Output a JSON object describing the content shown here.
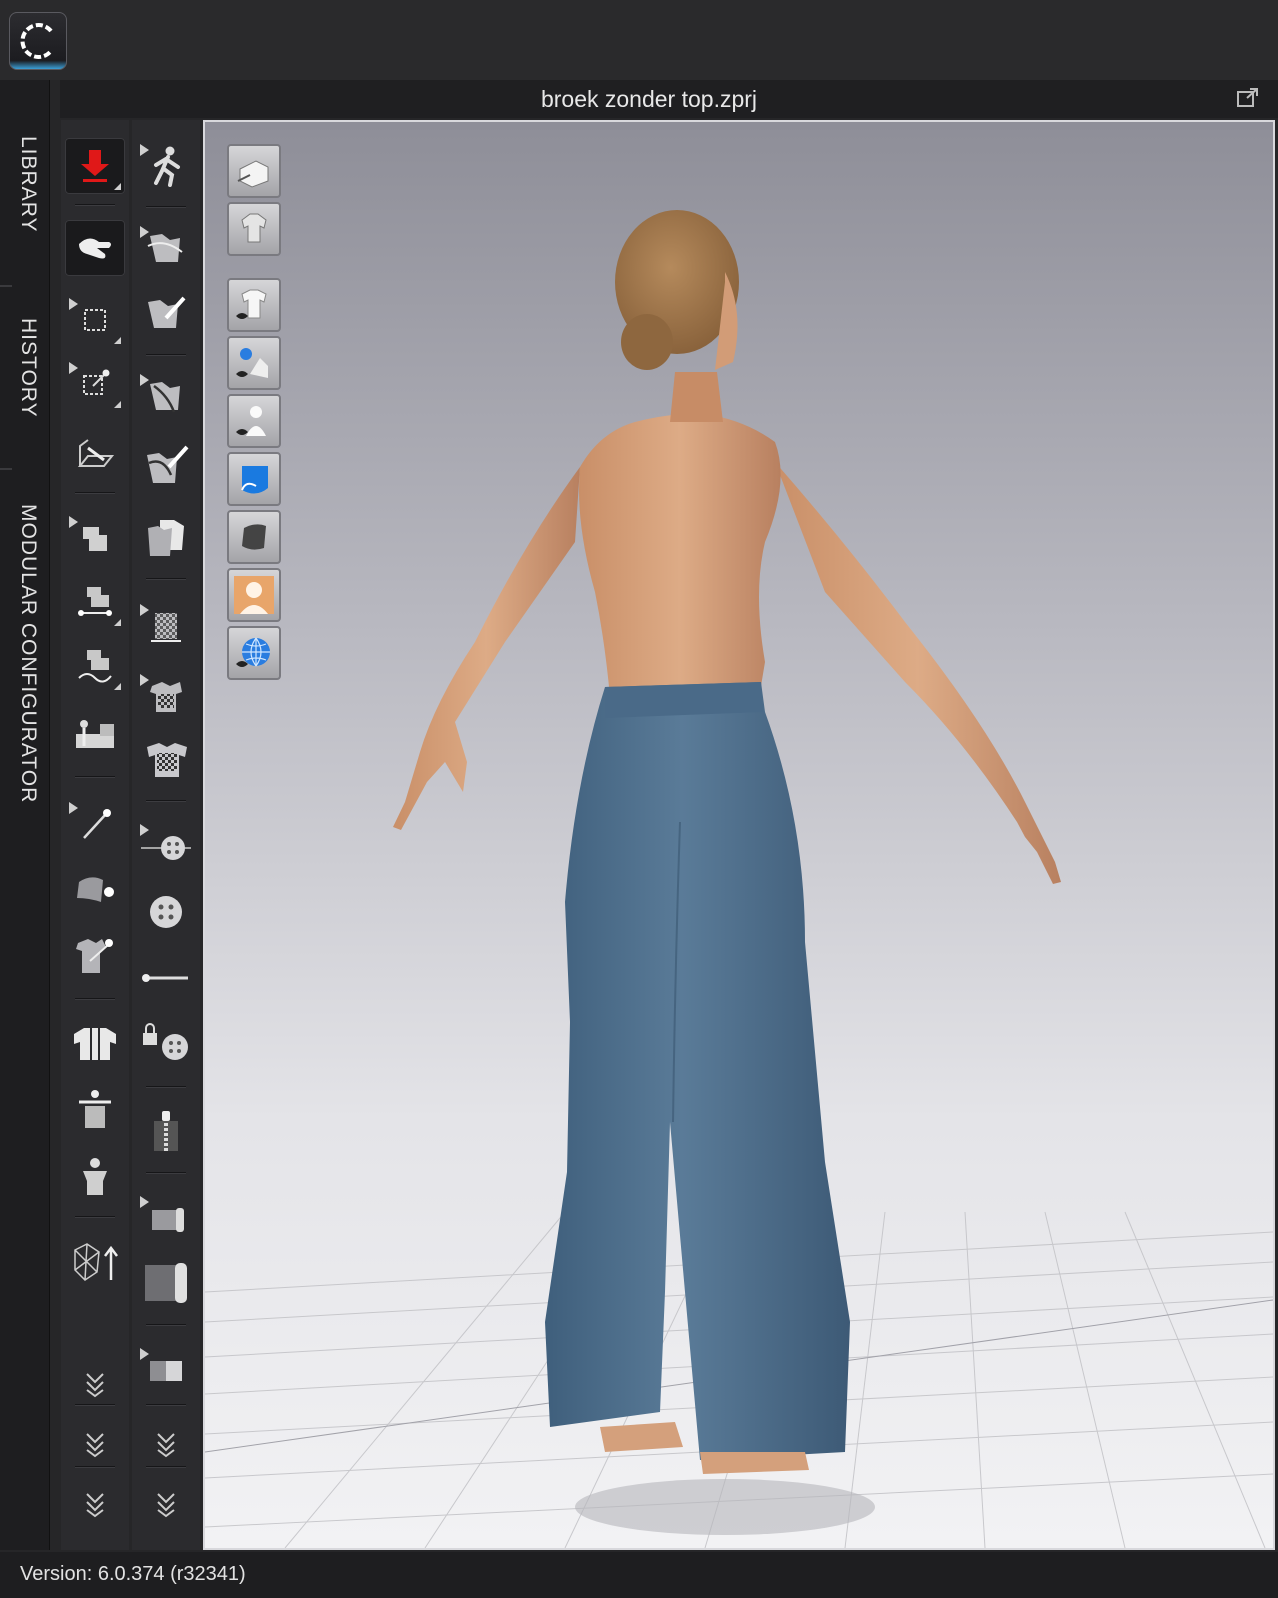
{
  "app": {
    "logo_icon": "clo-logo-icon"
  },
  "window": {
    "title": "broek zonder top.zprj",
    "popout_icon": "popout-icon"
  },
  "side_tabs": [
    {
      "label": "LIBRARY"
    },
    {
      "label": "HISTORY"
    },
    {
      "label": "MODULAR CONFIGURATOR"
    }
  ],
  "toolbar_left": [
    "import-avatar-icon",
    "hand-transform-icon",
    "select-pattern-icon",
    "transform-pattern-icon",
    "fold-arrangement-icon",
    "segment-sewing-icon",
    "free-sewing-icon",
    "m-n-sewing-icon",
    "sewing-machine-icon",
    "pin-icon",
    "tack-icon",
    "fold-tack-icon",
    "garment-group-icon",
    "arrangement-icon",
    "avatar-pose-icon",
    "polygon-up-icon",
    "more-tools-icon"
  ],
  "toolbar_right": [
    "walk-animation-icon",
    "edit-curvature-icon",
    "edit-pen-icon",
    "edit-segment-icon",
    "brush-curve-icon",
    "copy-pattern-icon",
    "texture-edit-icon",
    "fabric-grid-icon",
    "fabric-texture-icon",
    "button-select-icon",
    "button-icon",
    "buttonhole-icon",
    "lock-button-icon",
    "zipper-icon",
    "fold-pattern-icon",
    "fabric-roll-icon",
    "block-icon",
    "more-tools-icon"
  ],
  "viewport_tools": [
    "box-view-icon",
    "garment-view-icon",
    "show-garment-icon",
    "show-pattern-icon",
    "show-avatar-icon",
    "fabric-display-icon",
    "texture-display-icon",
    "avatar-display-icon",
    "environment-icon"
  ],
  "status": {
    "version": "Version: 6.0.374 (r32341)"
  },
  "colors": {
    "pants": "#4d6e8c",
    "skin": "#d6a27c",
    "hair": "#a37a4f",
    "import_accent": "#e01818",
    "viewport_top": "#8e8e98"
  }
}
